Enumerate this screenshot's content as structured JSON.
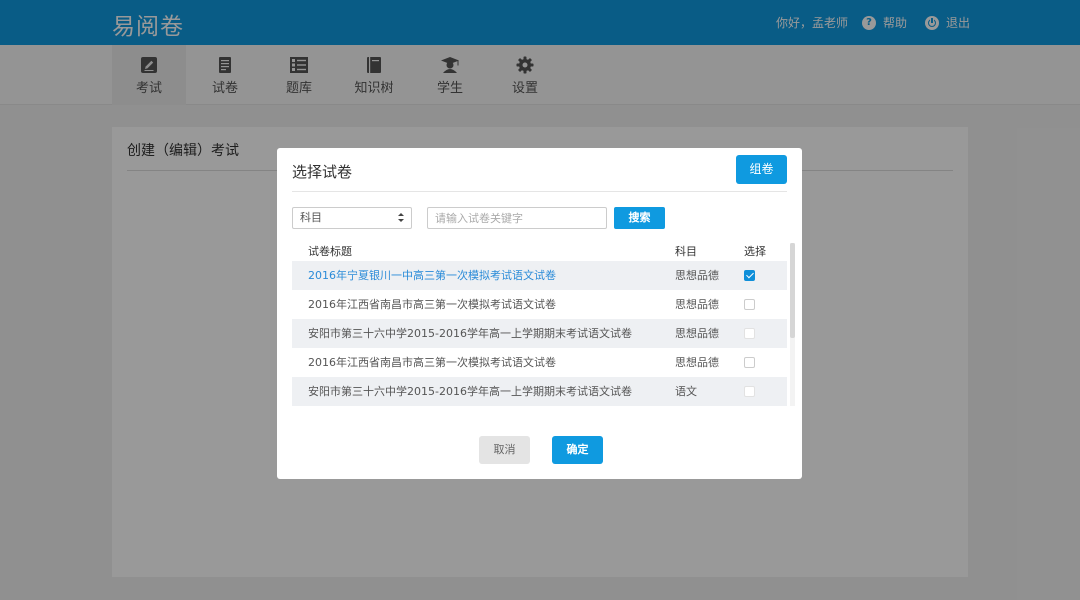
{
  "app": {
    "brand": "易阅卷"
  },
  "header": {
    "greeting": "你好，孟老师",
    "help_label": "帮助",
    "help_icon": "question-circle-icon",
    "logout_label": "退出",
    "logout_icon": "power-icon"
  },
  "nav": {
    "active": "考试",
    "items": [
      {
        "label": "考试",
        "icon": "edit-icon"
      },
      {
        "label": "试卷",
        "icon": "document-icon"
      },
      {
        "label": "题库",
        "icon": "list-icon"
      },
      {
        "label": "知识树",
        "icon": "book-icon"
      },
      {
        "label": "学生",
        "icon": "graduate-icon"
      },
      {
        "label": "设置",
        "icon": "gear-icon"
      }
    ]
  },
  "page": {
    "title": "创建（编辑）考试"
  },
  "modal": {
    "title": "选择试卷",
    "compose_label": "组卷",
    "subject_select": "科目",
    "search_placeholder": "请输入试卷关键字",
    "search_value": "",
    "search_label": "搜索",
    "columns": {
      "title": "试卷标题",
      "subject": "科目",
      "select": "选择"
    },
    "rows": [
      {
        "title": "2016年宁夏银川一中高三第一次模拟考试语文试卷",
        "subject": "思想品德",
        "checked": true
      },
      {
        "title": "2016年江西省南昌市高三第一次模拟考试语文试卷",
        "subject": "思想品德",
        "checked": false
      },
      {
        "title": "安阳市第三十六中学2015-2016学年高一上学期期末考试语文试卷",
        "subject": "思想品德",
        "checked": false
      },
      {
        "title": "2016年江西省南昌市高三第一次模拟考试语文试卷",
        "subject": "思想品德",
        "checked": false
      },
      {
        "title": "安阳市第三十六中学2015-2016学年高一上学期期末考试语文试卷",
        "subject": "语文",
        "checked": false
      }
    ],
    "cancel_label": "取消",
    "confirm_label": "确定"
  },
  "colors": {
    "primary": "#0f9ae0",
    "selected_text": "#2a8bd8",
    "row_stripe": "#eef0f3",
    "overlay": "rgba(0,0,0,0.4)"
  }
}
